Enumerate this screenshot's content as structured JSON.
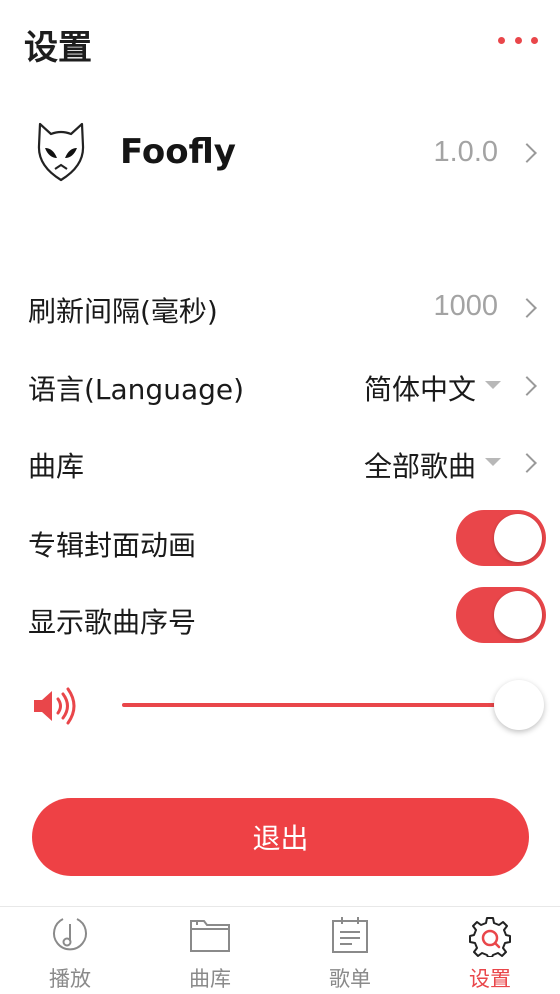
{
  "header": {
    "title": "设置",
    "more_icon": "more-dots-icon"
  },
  "app": {
    "logo_icon": "alien-logo-icon",
    "name": "Foofly",
    "version": "1.0.0"
  },
  "settings": {
    "refresh": {
      "label": "刷新间隔(毫秒)",
      "value": "1000"
    },
    "language": {
      "label": "语言(Language)",
      "value": "简体中文"
    },
    "library": {
      "label": "曲库",
      "value": "全部歌曲"
    },
    "album_animation": {
      "label": "专辑封面动画",
      "enabled": true
    },
    "show_track_number": {
      "label": "显示歌曲序号",
      "enabled": true
    },
    "volume": {
      "icon": "volume-icon",
      "level": 1.0
    }
  },
  "logout_label": "退出",
  "tabs": [
    {
      "label": "播放",
      "icon": "music-note-icon",
      "active": false
    },
    {
      "label": "曲库",
      "icon": "folder-icon",
      "active": false
    },
    {
      "label": "歌单",
      "icon": "playlist-icon",
      "active": false
    },
    {
      "label": "设置",
      "icon": "settings-gear-icon",
      "active": true
    }
  ],
  "colors": {
    "accent": "#e9464a",
    "button": "#ee4145",
    "secondary_text": "#a3a3a3",
    "inactive_tab": "#8a8a8a"
  }
}
